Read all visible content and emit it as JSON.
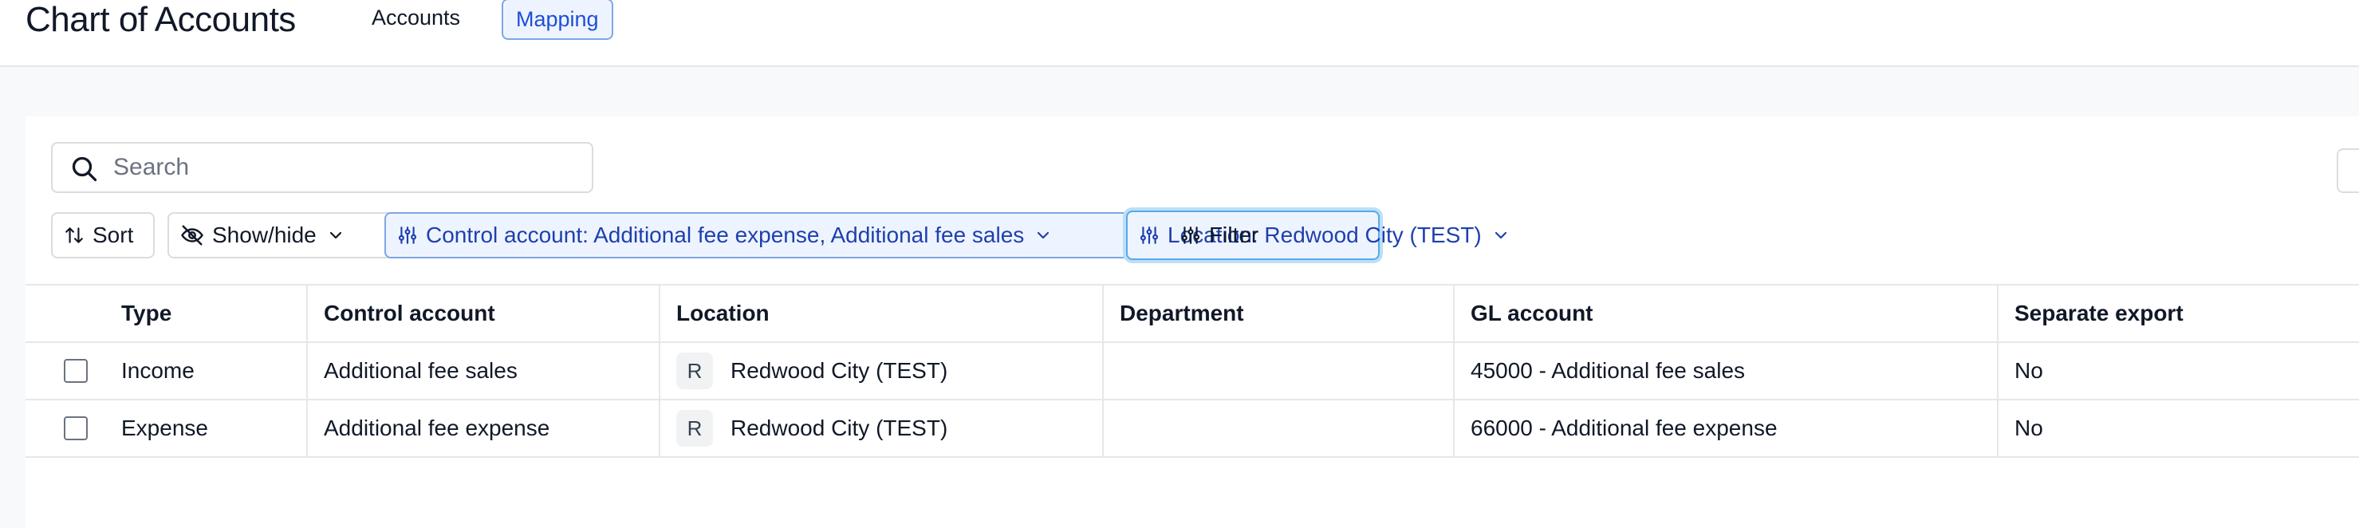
{
  "header": {
    "title": "Chart of Accounts",
    "tabs": [
      {
        "label": "Accounts",
        "active": false
      },
      {
        "label": "Mapping",
        "active": true
      }
    ]
  },
  "toolbar": {
    "search_placeholder": "Search",
    "sort_label": "Sort",
    "show_hide_label": "Show/hide",
    "filters": [
      {
        "label": "Control account: Additional fee expense, Additional fee sales",
        "icon": "sliders-icon"
      },
      {
        "label": "Location: Redwood City (TEST)",
        "icon": "sliders-icon"
      }
    ],
    "filter_label": "Filter"
  },
  "table": {
    "columns": [
      "Type",
      "Control account",
      "Location",
      "Department",
      "GL account",
      "Separate export"
    ],
    "rows": [
      {
        "type": "Income",
        "control_account": "Additional fee sales",
        "location_initial": "R",
        "location": "Redwood City (TEST)",
        "department": "",
        "gl_account": "45000 - Additional fee sales",
        "separate_export": "No"
      },
      {
        "type": "Expense",
        "control_account": "Additional fee expense",
        "location_initial": "R",
        "location": "Redwood City (TEST)",
        "department": "",
        "gl_account": "66000 - Additional fee expense",
        "separate_export": "No"
      }
    ]
  },
  "colors": {
    "accent": "#1e40af",
    "chip_bg": "#eef4ff",
    "chip_border": "#7ea6e6",
    "border": "#e5e7eb"
  }
}
